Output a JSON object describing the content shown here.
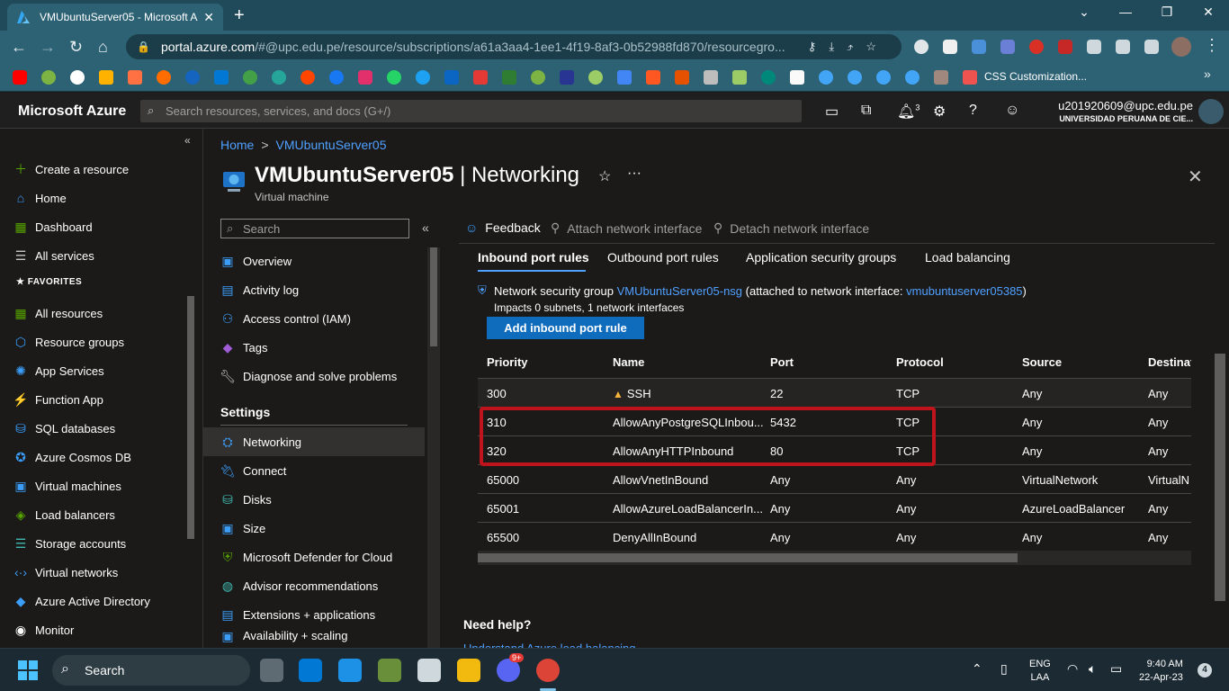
{
  "browser": {
    "tab_title": "VMUbuntuServer05 - Microsoft Azure",
    "new_tab": "+",
    "url_host": "portal.azure.com",
    "url_path": "/#@upc.edu.pe/resource/subscriptions/a61a3aa4-1ee1-4f19-8af3-0b52988fd870/resourcegro...",
    "bookmark_label": "CSS Customization..."
  },
  "azure": {
    "brand": "Microsoft Azure",
    "search_placeholder": "Search resources, services, and docs (G+/)",
    "account_email": "u201920609@upc.edu.pe",
    "account_org": "UNIVERSIDAD PERUANA DE CIE...",
    "notification_count": "3"
  },
  "leftnav": {
    "items": [
      {
        "label": "Create a resource",
        "icon": "plus-icon"
      },
      {
        "label": "Home",
        "icon": "home-icon"
      },
      {
        "label": "Dashboard",
        "icon": "dashboard-icon"
      },
      {
        "label": "All services",
        "icon": "list-icon"
      }
    ],
    "favorites_heading": "FAVORITES",
    "favorites": [
      {
        "label": "All resources",
        "icon": "grid-icon"
      },
      {
        "label": "Resource groups",
        "icon": "resource-group-icon"
      },
      {
        "label": "App Services",
        "icon": "app-services-icon"
      },
      {
        "label": "Function App",
        "icon": "function-icon"
      },
      {
        "label": "SQL databases",
        "icon": "sql-icon"
      },
      {
        "label": "Azure Cosmos DB",
        "icon": "cosmos-icon"
      },
      {
        "label": "Virtual machines",
        "icon": "vm-icon"
      },
      {
        "label": "Load balancers",
        "icon": "load-balancer-icon"
      },
      {
        "label": "Storage accounts",
        "icon": "storage-icon"
      },
      {
        "label": "Virtual networks",
        "icon": "vnet-icon"
      },
      {
        "label": "Azure Active Directory",
        "icon": "aad-icon"
      },
      {
        "label": "Monitor",
        "icon": "monitor-icon"
      }
    ]
  },
  "breadcrumb": {
    "home": "Home",
    "separator": ">",
    "current": "VMUbuntuServer05"
  },
  "page": {
    "title_resource": "VMUbuntuServer05",
    "title_separator": "|",
    "title_section": "Networking",
    "subtitle": "Virtual machine",
    "star": "☆",
    "more": "···",
    "close": "✕"
  },
  "resource_menu": {
    "search_placeholder": "Search",
    "items_top": [
      {
        "label": "Overview",
        "icon": "overview-icon"
      },
      {
        "label": "Activity log",
        "icon": "activity-log-icon"
      },
      {
        "label": "Access control (IAM)",
        "icon": "iam-icon"
      },
      {
        "label": "Tags",
        "icon": "tag-icon"
      },
      {
        "label": "Diagnose and solve problems",
        "icon": "wrench-icon"
      }
    ],
    "settings_heading": "Settings",
    "items_settings": [
      {
        "label": "Networking",
        "icon": "networking-icon",
        "selected": true
      },
      {
        "label": "Connect",
        "icon": "connect-icon"
      },
      {
        "label": "Disks",
        "icon": "disk-icon"
      },
      {
        "label": "Size",
        "icon": "size-icon"
      },
      {
        "label": "Microsoft Defender for Cloud",
        "icon": "defender-icon"
      },
      {
        "label": "Advisor recommendations",
        "icon": "advisor-icon"
      },
      {
        "label": "Extensions + applications",
        "icon": "extensions-icon"
      },
      {
        "label": "Availability + scaling",
        "icon": "availability-icon"
      }
    ]
  },
  "commands": {
    "feedback": "Feedback",
    "attach": "Attach network interface",
    "detach": "Detach network interface"
  },
  "tabs": [
    "Inbound port rules",
    "Outbound port rules",
    "Application security groups",
    "Load balancing"
  ],
  "nsg": {
    "prefix": "Network security group",
    "name": "VMUbuntuServer05-nsg",
    "attached_prefix": "(attached to network interface:",
    "nic": "vmubuntuserver05385",
    "attached_suffix": ")",
    "impacts": "Impacts 0 subnets, 1 network interfaces",
    "add_button": "Add inbound port rule"
  },
  "rules_table": {
    "columns": [
      "Priority",
      "Name",
      "Port",
      "Protocol",
      "Source",
      "Destinat"
    ],
    "rows": [
      {
        "priority": "300",
        "name": "SSH",
        "port": "22",
        "protocol": "TCP",
        "source": "Any",
        "destination": "Any",
        "warning": true
      },
      {
        "priority": "310",
        "name": "AllowAnyPostgreSQLInbou...",
        "port": "5432",
        "protocol": "TCP",
        "source": "Any",
        "destination": "Any"
      },
      {
        "priority": "320",
        "name": "AllowAnyHTTPInbound",
        "port": "80",
        "protocol": "TCP",
        "source": "Any",
        "destination": "Any"
      },
      {
        "priority": "65000",
        "name": "AllowVnetInBound",
        "port": "Any",
        "protocol": "Any",
        "source": "VirtualNetwork",
        "destination": "VirtualN"
      },
      {
        "priority": "65001",
        "name": "AllowAzureLoadBalancerIn...",
        "port": "Any",
        "protocol": "Any",
        "source": "AzureLoadBalancer",
        "destination": "Any"
      },
      {
        "priority": "65500",
        "name": "DenyAllInBound",
        "port": "Any",
        "protocol": "Any",
        "source": "Any",
        "destination": "Any"
      }
    ]
  },
  "help": {
    "heading": "Need help?",
    "link": "Understand Azure load balancing"
  },
  "taskbar": {
    "search": "Search",
    "lang_top": "ENG",
    "lang_bottom": "LAA",
    "time": "9:40 AM",
    "date": "22-Apr-23",
    "notifications": "4",
    "discord_badge": "9+"
  },
  "colors": {
    "accent": "#4fa0ff",
    "highlight": "#c0141c",
    "button": "#0f6cbd"
  }
}
